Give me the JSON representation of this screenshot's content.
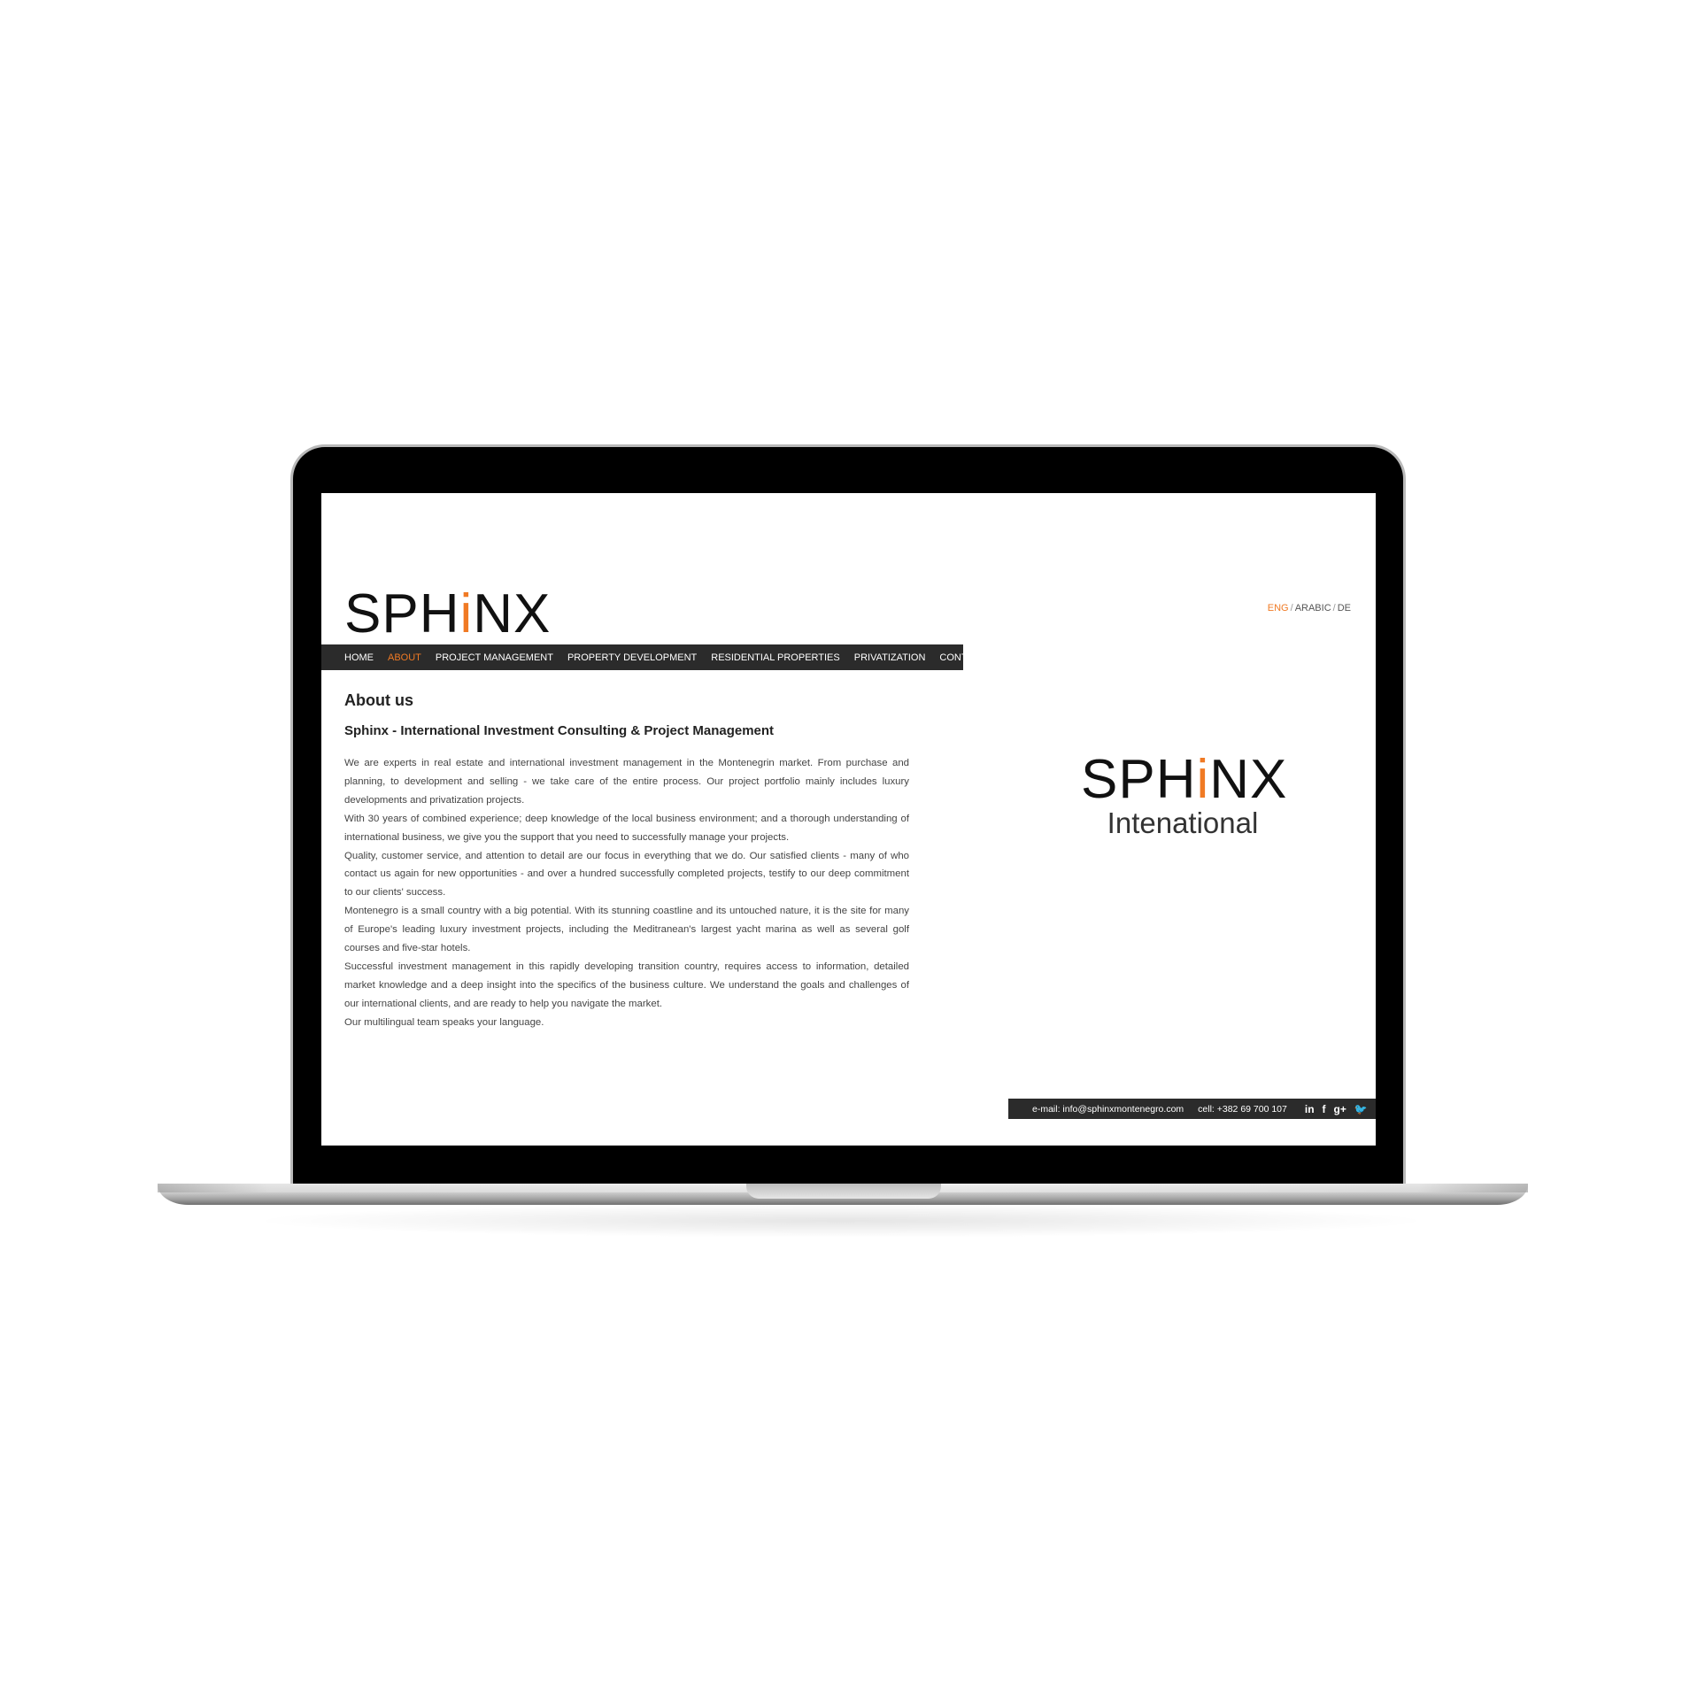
{
  "brand": {
    "logo_prefix": "SPH",
    "logo_accent": "i",
    "logo_suffix": "NX",
    "accent_color": "#f07a24",
    "nav_bg_color": "#2b2b2b"
  },
  "languages": {
    "items": [
      "ENG",
      "ARABIC",
      "DE"
    ],
    "separator": "/",
    "active": "ENG"
  },
  "nav": {
    "items": [
      "HOME",
      "ABOUT",
      "PROJECT MANAGEMENT",
      "PROPERTY DEVELOPMENT",
      "RESIDENTIAL PROPERTIES",
      "PRIVATIZATION",
      "CONTACT"
    ],
    "active": "ABOUT"
  },
  "content": {
    "title": "About us",
    "subtitle": "Sphinx - International Investment Consulting & Project Management",
    "paragraphs": [
      "We are experts in real estate and international investment management in the Montenegrin market. From purchase and planning, to development and selling - we take care of the entire process. Our project portfolio mainly includes luxury developments and privatization projects.",
      "With 30 years of combined experience; deep knowledge of the local business environment; and a thorough understanding of international business, we give you the support that you need to successfully manage your projects.",
      "Quality, customer service, and attention to detail are our focus in everything that we do. Our satisfied clients - many of who contact us again for new opportunities - and over a hundred successfully completed projects, testify to our deep commitment to our clients' success.",
      "Montenegro is a small country with a big potential. With its stunning coastline and its untouched nature, it is the site for many of Europe's leading luxury investment projects, including the Meditranean's largest yacht marina as well as several golf courses and five-star hotels.",
      "Successful investment management in this rapidly developing transition country, requires access to information, detailed market knowledge and a deep insight into the specifics of the business culture. We understand the goals and challenges of our international clients, and are ready to help you navigate the market.",
      "Our multilingual team speaks your language."
    ]
  },
  "side_logo": {
    "prefix": "SPH",
    "accent": "i",
    "suffix": "NX",
    "subtitle": "Intenational"
  },
  "footer": {
    "email": "e-mail: info@sphinxmontenegro.com",
    "phone": "cell: +382 69 700 107",
    "icons": [
      {
        "name": "linkedin-icon",
        "glyph": "in"
      },
      {
        "name": "facebook-icon",
        "glyph": "f"
      },
      {
        "name": "google-plus-icon",
        "glyph": "g+"
      },
      {
        "name": "twitter-icon",
        "glyph": "🐦"
      }
    ]
  }
}
